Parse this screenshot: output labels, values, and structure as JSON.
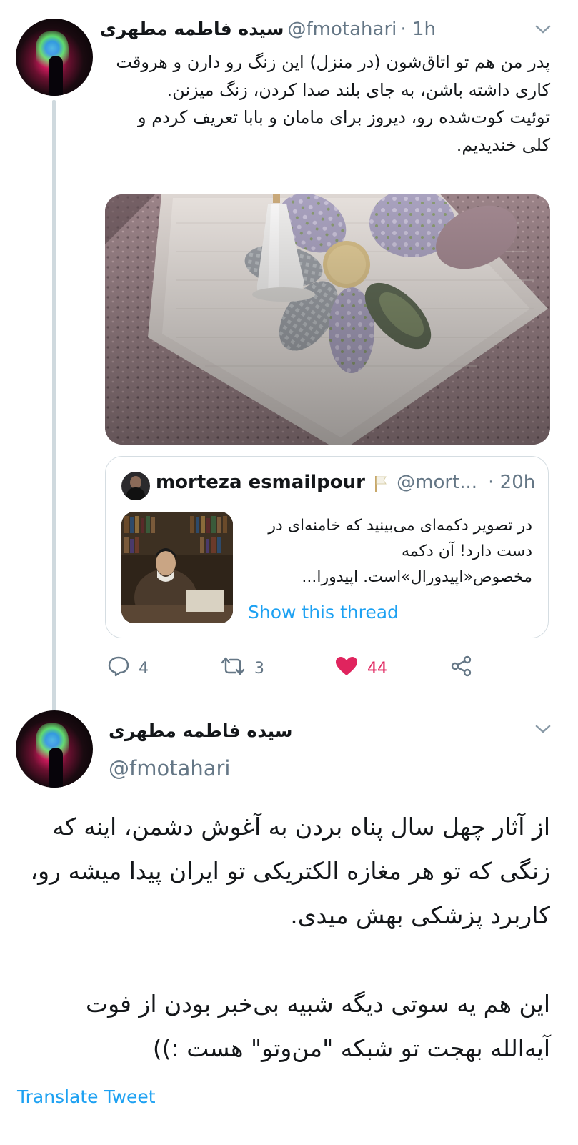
{
  "tweet1": {
    "display_name": "سیده فاطمه مطهری",
    "handle": "@fmotahari",
    "time": "· 1h",
    "text": "پدر من هم تو اتاق‌شون (در منزل) این زنگ رو دارن و هروقت کاری داشته باشن، به جای بلند صدا کردن، زنگ میزنن.\nتوئیت کوت‌شده رو، دیروز برای مامان و بابا تعریف کردم و کلی خندیدیم.",
    "quoted": {
      "display_name": "morteza esmailpour",
      "handle": "@mort...",
      "time": "· 20h",
      "text": "در تصویر دکمه‌ای می‌بینید که خامنه‌ای در دست دارد! آن دکمه مخصوص«اپیدورال»است. اپیدورا...",
      "link": "Show this thread"
    },
    "actions": {
      "replies": "4",
      "retweets": "3",
      "likes": "44"
    }
  },
  "tweet2": {
    "display_name": "سیده فاطمه مطهری",
    "handle": "@fmotahari",
    "text": "از آثار چهل سال پناه بردن به آغوش دشمن، اینه که زنگی که تو هر مغازه الکتریکی تو ایران پیدا میشه رو، کاربرد پزشکی بهش میدی.\n\nاین هم یه سوتی دیگه شبیه بی‌خبر بودن از فوت آیه‌الله بهجت تو شبکه \"من‌وتو\" هست :))",
    "translate": "Translate Tweet"
  },
  "colors": {
    "link": "#1da1f2",
    "like": "#e0245e",
    "muted": "#657786",
    "thread_line": "#cfd9de"
  }
}
